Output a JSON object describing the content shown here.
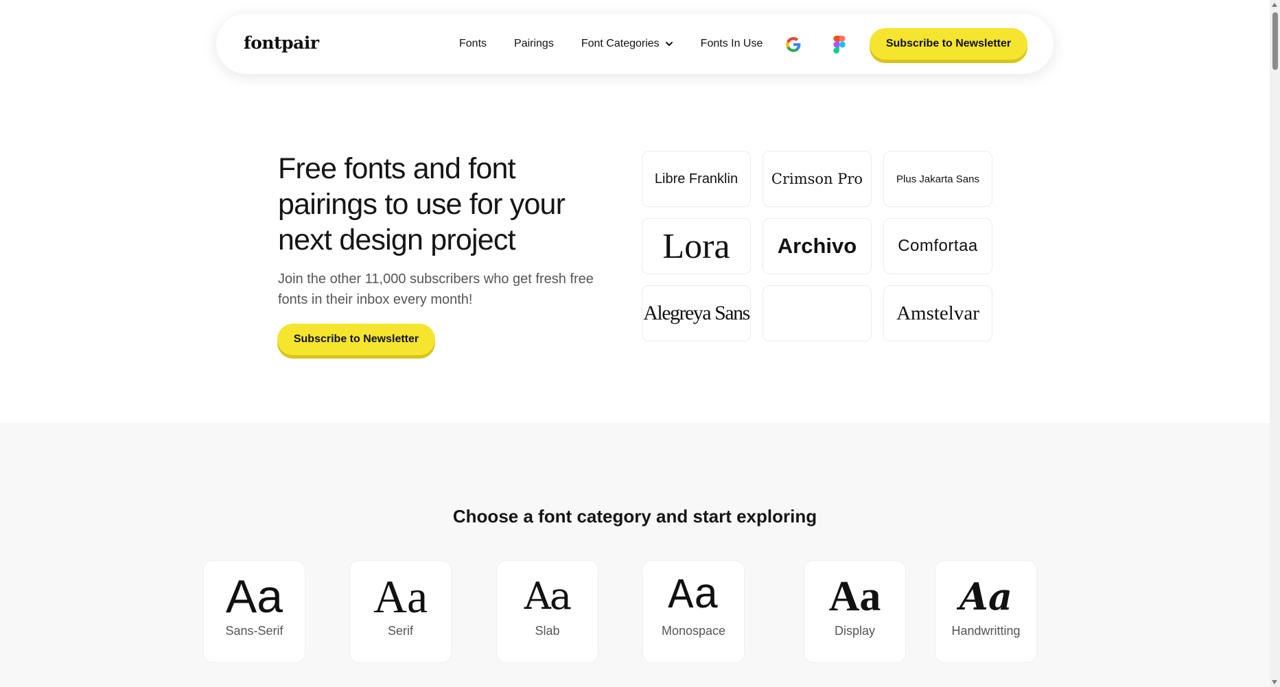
{
  "header": {
    "logo": "fontpair",
    "nav": [
      "Fonts",
      "Pairings",
      "Font Categories",
      "Fonts In Use"
    ],
    "cta": "Subscribe to Newsletter",
    "icons": [
      "google-icon",
      "figma-icon",
      "chevron-down-icon"
    ]
  },
  "hero": {
    "title": "Free fonts and font pairings to use for your next design project",
    "subtitle": "Join the other 11,000 subscribers who get fresh free fonts in their inbox every month!",
    "cta": "Subscribe to Newsletter"
  },
  "font_tiles": [
    "Libre Franklin",
    "Crimson Pro",
    "Plus Jakarta Sans",
    "Lora",
    "Archivo",
    "Comfortaa",
    "Alegreya Sans",
    "",
    "Amstelvar"
  ],
  "categories": {
    "heading": "Choose a font category and start exploring",
    "items": [
      {
        "glyph": "Aa",
        "label": "Sans-Serif"
      },
      {
        "glyph": "Aa",
        "label": "Serif"
      },
      {
        "glyph": "Aa",
        "label": "Slab"
      },
      {
        "glyph": "Aa",
        "label": "Monospace"
      },
      {
        "glyph": "Aa",
        "label": "Display"
      },
      {
        "glyph": "Aa",
        "label": "Handwritting"
      }
    ]
  },
  "colors": {
    "accent_yellow": "#f5e52e",
    "accent_shadow": "#d8c51a",
    "section_bg": "#f7f8f7"
  }
}
